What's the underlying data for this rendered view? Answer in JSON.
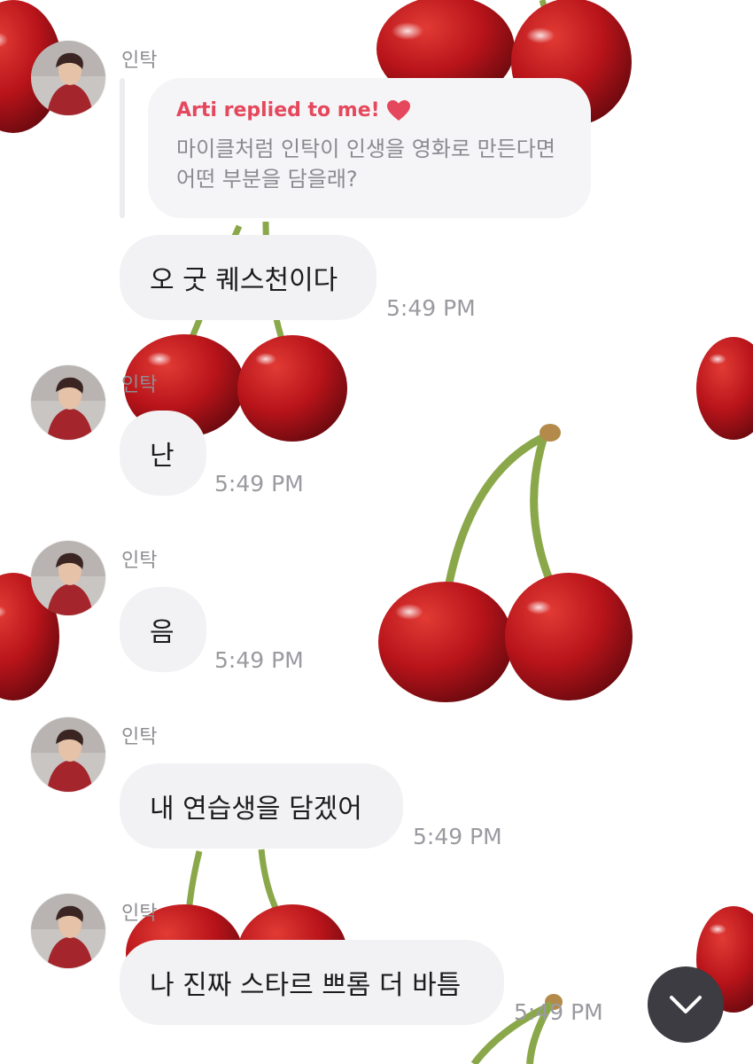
{
  "reply_header": "Arti replied to me!",
  "reply_quote": "마이클처럼 인탁이 인생을 영화로 만든다면 어떤 부분을 담을래?",
  "sender_name": "인탁",
  "messages": [
    {
      "text": "오 굿 퀘스천이다",
      "time": "5:49 PM"
    },
    {
      "text": "난",
      "time": "5:49 PM"
    },
    {
      "text": "음",
      "time": "5:49 PM"
    },
    {
      "text": "내 연습생을 담겠어",
      "time": "5:49 PM"
    },
    {
      "text": "나 진짜 스타르 쁘롬 더 바틈",
      "time": "5:49 PM"
    }
  ],
  "colors": {
    "accent": "#e5485d",
    "bubble": "#f2f2f4",
    "scroll_button": "#3c3c42",
    "cherry": "#c0151c"
  },
  "icons": {
    "heart": "heart-icon",
    "scroll": "chevron-down-icon",
    "background": "cherry-wallpaper"
  }
}
